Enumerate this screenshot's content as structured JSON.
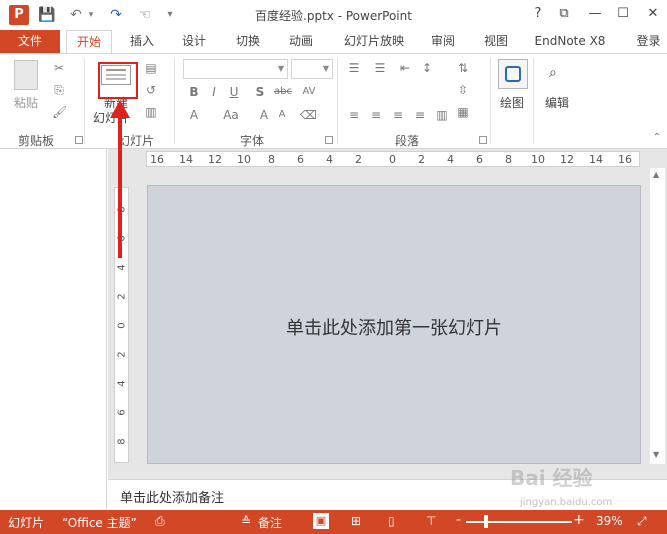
{
  "window": {
    "title": "百度经验.pptx - PowerPoint",
    "app_icon": "P",
    "controls": [
      "?",
      "⧉",
      "—",
      "☐",
      "✕"
    ]
  },
  "qat": {
    "save": "💾",
    "undo": "↶",
    "redo": "↷",
    "touch": "☜",
    "more": "▾"
  },
  "tabs": [
    "文件",
    "开始",
    "插入",
    "设计",
    "切换",
    "动画",
    "幻灯片放映",
    "审阅",
    "视图",
    "EndNote X8",
    "登录"
  ],
  "ribbon": {
    "clipboard": {
      "paste": "粘贴",
      "label": "剪贴板"
    },
    "slides": {
      "new_slide_line1": "新建",
      "new_slide_line2": "幻灯片",
      "label": "幻灯片"
    },
    "font": {
      "label": "字体",
      "bold": "B",
      "italic": "I",
      "underline": "U",
      "shadow": "S",
      "strike": "abc",
      "spacing": "AV",
      "grow": "A",
      "size": "Aa"
    },
    "paragraph": {
      "label": "段落"
    },
    "drawing": {
      "label": "绘图"
    },
    "editing": {
      "label": "编辑"
    }
  },
  "ruler": {
    "h_marks": [
      "16",
      "14",
      "12",
      "10",
      "8",
      "6",
      "4",
      "2",
      "0",
      "2",
      "4",
      "6",
      "8",
      "10",
      "12",
      "14",
      "16"
    ],
    "v_marks": [
      "8",
      "6",
      "4",
      "2",
      "0",
      "2",
      "4",
      "6",
      "8"
    ]
  },
  "slide": {
    "placeholder": "单击此处添加第一张幻灯片"
  },
  "notes": {
    "placeholder": "单击此处添加备注"
  },
  "status": {
    "slide": "幻灯片",
    "theme": "“Office 主题”",
    "notes": "备注",
    "zoom": "39%",
    "zoom_minus": "-",
    "zoom_plus": "+"
  },
  "watermark": {
    "main": "Bai 经验",
    "sub": "jingyan.baidu.com"
  },
  "colors": {
    "accent": "#d24726",
    "slide_bg": "#cfd4dc",
    "annotation": "#e0221f"
  }
}
